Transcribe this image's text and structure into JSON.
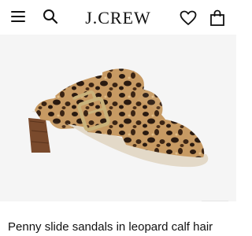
{
  "header": {
    "brand": "J.CREW",
    "icons": [
      "menu-icon",
      "search-icon",
      "heart-icon",
      "shopping-bag-icon"
    ]
  },
  "product": {
    "title": "Penny slide sandals in leopard calf hair",
    "zoom_icon": "expand-icon"
  },
  "colors": {
    "background": "#ffffff",
    "image_background": "#f5f5f5",
    "leopard_base": "#c79a63",
    "leopard_spots": "#2a1a10",
    "heel_wood": "#7a4a2c",
    "buckle_gold": "#c9b27a"
  }
}
